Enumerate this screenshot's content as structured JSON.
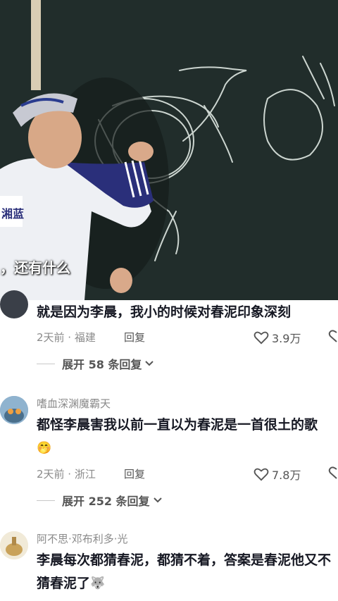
{
  "video": {
    "subtitle": "，还有什么",
    "jersey_text": "湘蓝"
  },
  "comments": [
    {
      "username": "",
      "text": "就是因为李晨，我小的时候对春泥印象深刻",
      "time_location": "2天前 · 福建",
      "reply_label": "回复",
      "likes": "3.9万",
      "expand_label": "展开 58 条回复"
    },
    {
      "username": "嗜血深渊魔霸天",
      "text": "都怪李晨害我以前一直以为春泥是一首很土的歌",
      "emoji": "🤭",
      "time_location": "2天前 · 浙江",
      "reply_label": "回复",
      "likes": "7.8万",
      "expand_label": "展开 252 条回复"
    },
    {
      "username": "阿不思·邓布利多·光",
      "text": "李晨每次都猜春泥，都猜不着，答案是春泥他又不猜春泥了",
      "emoji": "🐺"
    }
  ],
  "colors": {
    "chalkboard": "#1f2a28",
    "chalk": "#dfe8e2",
    "primary_text": "#161823",
    "secondary_text": "#8a8a8a"
  }
}
